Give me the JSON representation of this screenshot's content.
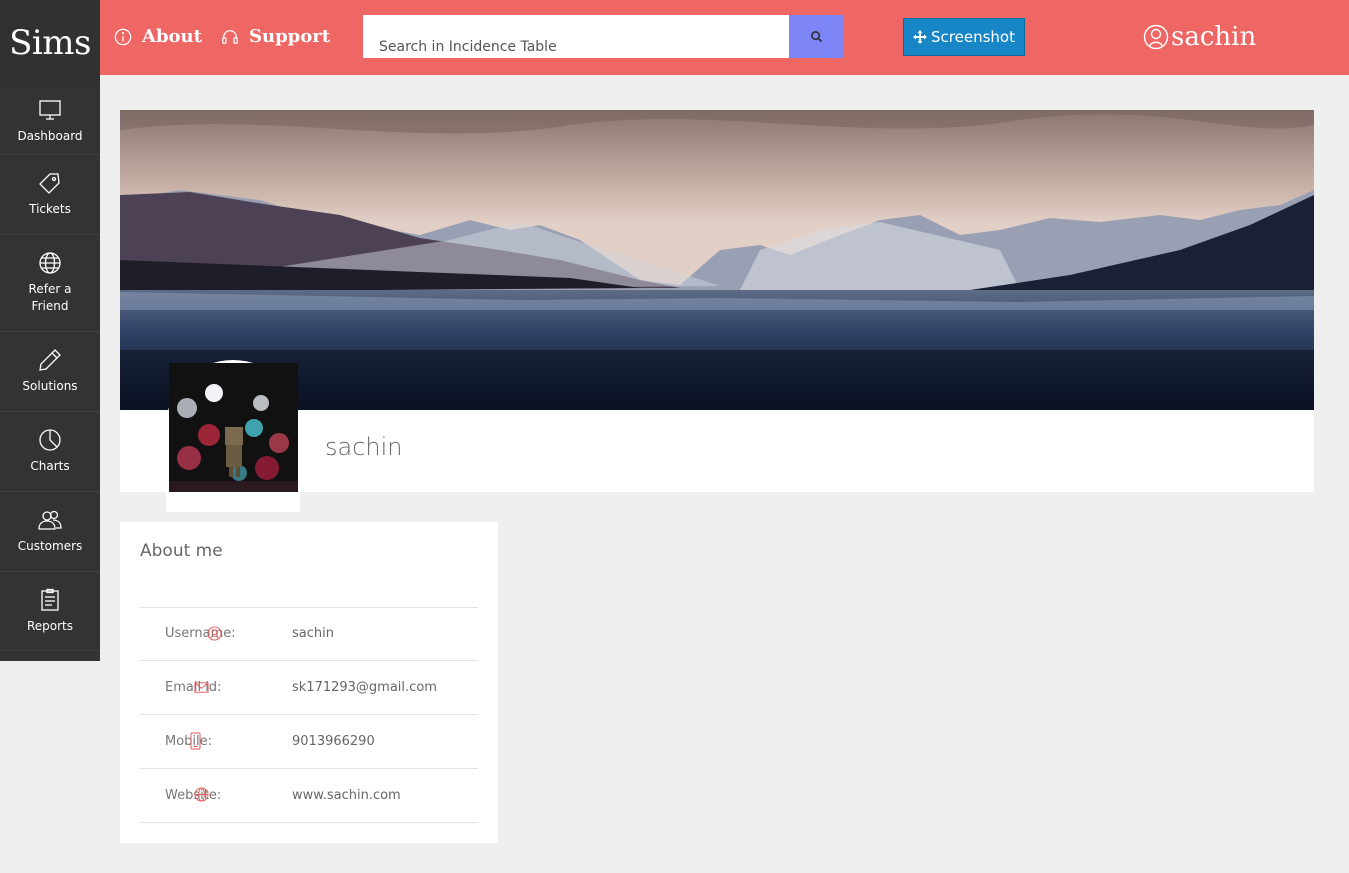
{
  "brand": {
    "name": "Sims"
  },
  "sidebar": {
    "items": [
      {
        "label": "Dashboard",
        "icon": "monitor-icon"
      },
      {
        "label": "Tickets",
        "icon": "tag-icon"
      },
      {
        "label": "Refer a Friend",
        "icon": "globe-icon"
      },
      {
        "label": "Solutions",
        "icon": "pencil-icon"
      },
      {
        "label": "Charts",
        "icon": "pie-chart-icon"
      },
      {
        "label": "Customers",
        "icon": "users-icon"
      },
      {
        "label": "Reports",
        "icon": "clipboard-icon"
      }
    ]
  },
  "header": {
    "about_label": "About",
    "support_label": "Support",
    "search_placeholder": "Search in Incidence Table",
    "screenshot_label": "Screenshot",
    "user_name": "sachin",
    "accent": "#ee6764",
    "search_button_color": "#7e85f7",
    "screenshot_button_color": "#1786c6"
  },
  "profile": {
    "name": "sachin"
  },
  "about": {
    "title": "About me",
    "rows": [
      {
        "label": "Username:",
        "value": "sachin",
        "icon": "user-icon"
      },
      {
        "label": "Email id:",
        "value": "sk171293@gmail.com",
        "icon": "mail-icon"
      },
      {
        "label": "Mobile:",
        "value": "9013966290",
        "icon": "phone-icon"
      },
      {
        "label": "Website:",
        "value": "www.sachin.com",
        "icon": "globe-icon"
      }
    ]
  }
}
